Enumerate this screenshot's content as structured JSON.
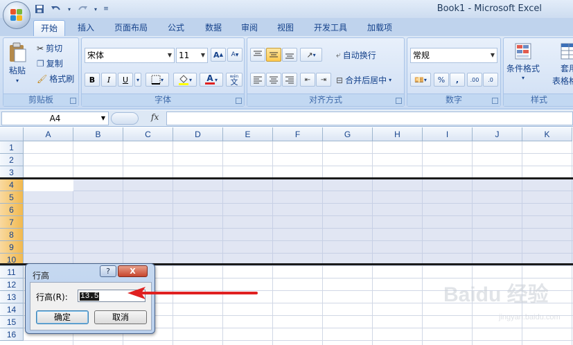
{
  "window": {
    "title": "Book1 - Microsoft Excel",
    "quick_access": [
      "save-icon",
      "undo-icon",
      "redo-icon",
      "customize-icon"
    ]
  },
  "tabs": [
    {
      "label": "开始",
      "active": true
    },
    {
      "label": "插入"
    },
    {
      "label": "页面布局"
    },
    {
      "label": "公式"
    },
    {
      "label": "数据"
    },
    {
      "label": "审阅"
    },
    {
      "label": "视图"
    },
    {
      "label": "开发工具"
    },
    {
      "label": "加载项"
    }
  ],
  "ribbon": {
    "clipboard": {
      "label": "剪贴板",
      "paste": "粘贴",
      "cut": "剪切",
      "copy": "复制",
      "format_painter": "格式刷"
    },
    "font": {
      "label": "字体",
      "font_name": "宋体",
      "font_size": "11",
      "bold": "B",
      "italic": "I",
      "underline": "U",
      "font_color": "A",
      "phonetic": "文",
      "phonetic_small": "wén",
      "grow": "A",
      "shrink": "A"
    },
    "alignment": {
      "label": "对齐方式",
      "wrap_text": "自动换行",
      "merge_center": "合并后居中"
    },
    "number": {
      "label": "数字",
      "format": "常规",
      "percent": "%",
      "comma": ",",
      "inc_decimal": ".00",
      "dec_decimal": ".0"
    },
    "styles": {
      "label": "样式",
      "conditional": "条件格式",
      "table_line1": "套用",
      "table_line2": "表格格式"
    }
  },
  "formula_bar": {
    "name_box": "A4",
    "fx": "fx",
    "content": ""
  },
  "grid": {
    "columns": [
      "A",
      "B",
      "C",
      "D",
      "E",
      "F",
      "G",
      "H",
      "I",
      "J",
      "K"
    ],
    "rows": [
      "1",
      "2",
      "3",
      "4",
      "5",
      "6",
      "7",
      "8",
      "9",
      "10",
      "11",
      "12",
      "13",
      "14",
      "15",
      "16"
    ],
    "selected_rows": [
      "4",
      "5",
      "6",
      "7",
      "8",
      "9",
      "10"
    ]
  },
  "dialog": {
    "title": "行高",
    "help": "?",
    "close": "X",
    "field_label": "行高(R):",
    "value": "13.5",
    "ok": "确定",
    "cancel": "取消"
  },
  "annotation": {
    "color": "#e02020"
  },
  "watermark": {
    "text": "Baidu 经验",
    "sub": "jingyan.baidu.com"
  },
  "colors": {
    "ribbon_bg": "#dbe7f6",
    "header_selected": "#f1b94f",
    "selection": "#bcc8e4",
    "arrow": "#e02020"
  }
}
